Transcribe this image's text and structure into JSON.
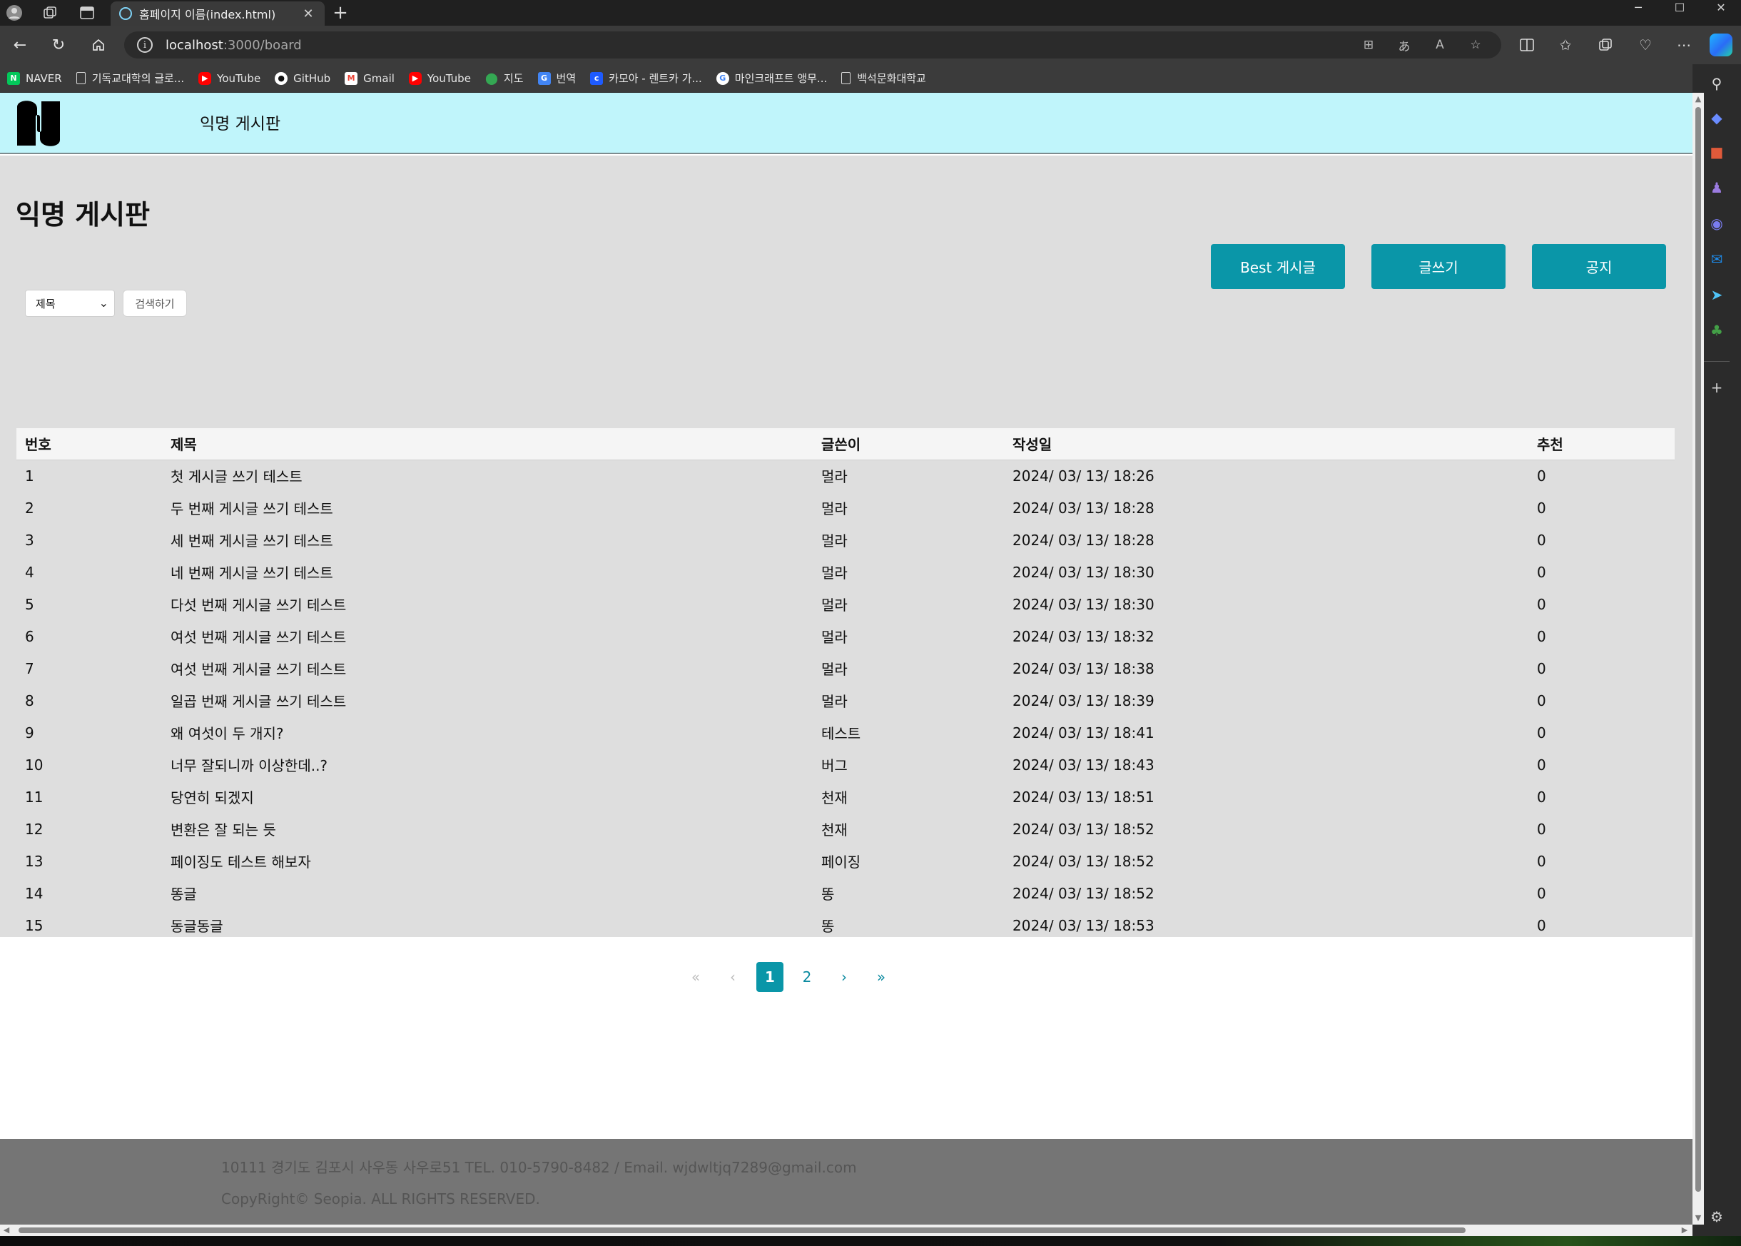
{
  "browser": {
    "tab": {
      "title": "홈페이지 이름(index.html)",
      "close": "✕"
    },
    "new_tab": "+",
    "window_controls": [
      "─",
      "☐",
      "✕"
    ],
    "address": {
      "host": "localhost",
      "path": ":3000/board"
    },
    "bookmarks": [
      {
        "label": "NAVER",
        "icon": "naver-icon",
        "color": "#03c75a"
      },
      {
        "label": "기독교대학의 글로...",
        "icon": "page-icon"
      },
      {
        "label": "YouTube",
        "icon": "youtube-icon",
        "color": "#ff0000"
      },
      {
        "label": "GitHub",
        "icon": "github-icon",
        "color": "#ffffff"
      },
      {
        "label": "Gmail",
        "icon": "gmail-icon",
        "color": "#ea4335"
      },
      {
        "label": "YouTube",
        "icon": "youtube-icon",
        "color": "#ff0000"
      },
      {
        "label": "지도",
        "icon": "maps-pin-icon",
        "color": "#34a853"
      },
      {
        "label": "번역",
        "icon": "translate-icon",
        "color": "#4285f4"
      },
      {
        "label": "카모아 - 렌트카 가...",
        "icon": "carmore-icon",
        "color": "#1e5bff"
      },
      {
        "label": "마인크래프트 앵무...",
        "icon": "google-icon",
        "color": "#ffffff"
      },
      {
        "label": "백석문화대학교",
        "icon": "page-icon"
      }
    ]
  },
  "site": {
    "header_title": "익명 게시판",
    "page_title": "익명 게시판",
    "buttons": {
      "best": "Best 게시글",
      "write": "글쓰기",
      "notice": "공지"
    },
    "search": {
      "select_value": "제목",
      "button": "검색하기"
    },
    "accent_color": "#0a96a8",
    "header_color": "#c0f5fb",
    "table": {
      "headers": [
        "번호",
        "제목",
        "글쓴이",
        "작성일",
        "추천"
      ],
      "rows": [
        [
          "1",
          "첫 게시글 쓰기 테스트",
          "멀라",
          "2024/ 03/ 13/ 18:26",
          "0"
        ],
        [
          "2",
          "두 번째 게시글 쓰기 테스트",
          "멀라",
          "2024/ 03/ 13/ 18:28",
          "0"
        ],
        [
          "3",
          "세 번째 게시글 쓰기 테스트",
          "멀라",
          "2024/ 03/ 13/ 18:28",
          "0"
        ],
        [
          "4",
          "네 번째 게시글 쓰기 테스트",
          "멀라",
          "2024/ 03/ 13/ 18:30",
          "0"
        ],
        [
          "5",
          "다섯 번째 게시글 쓰기 테스트",
          "멀라",
          "2024/ 03/ 13/ 18:30",
          "0"
        ],
        [
          "6",
          "여섯 번째 게시글 쓰기 테스트",
          "멀라",
          "2024/ 03/ 13/ 18:32",
          "0"
        ],
        [
          "7",
          "여섯 번째 게시글 쓰기 테스트",
          "멀라",
          "2024/ 03/ 13/ 18:38",
          "0"
        ],
        [
          "8",
          "일곱 번째 게시글 쓰기 테스트",
          "멀라",
          "2024/ 03/ 13/ 18:39",
          "0"
        ],
        [
          "9",
          "왜 여섯이 두 개지?",
          "테스트",
          "2024/ 03/ 13/ 18:41",
          "0"
        ],
        [
          "10",
          "너무 잘되니까 이상한데..?",
          "버그",
          "2024/ 03/ 13/ 18:43",
          "0"
        ],
        [
          "11",
          "당연히 되겠지",
          "천재",
          "2024/ 03/ 13/ 18:51",
          "0"
        ],
        [
          "12",
          "변환은 잘 되는 듯",
          "천재",
          "2024/ 03/ 13/ 18:52",
          "0"
        ],
        [
          "13",
          "페이징도 테스트 해보자",
          "페이징",
          "2024/ 03/ 13/ 18:52",
          "0"
        ],
        [
          "14",
          "똥글",
          "똥",
          "2024/ 03/ 13/ 18:52",
          "0"
        ],
        [
          "15",
          "동글동글",
          "똥",
          "2024/ 03/ 13/ 18:53",
          "0"
        ]
      ]
    },
    "pagination": {
      "first": "«",
      "prev": "‹",
      "pages": [
        "1",
        "2"
      ],
      "current": "1",
      "next": "›",
      "last": "»"
    },
    "footer": {
      "address": "10111 경기도 김포시 사우동 사우로51 TEL. 010-5790-8482 / Email. wjdwltjq7289@gmail.com",
      "copyright": "CopyRight© Seopia. ALL RIGHTS RESERVED."
    }
  }
}
